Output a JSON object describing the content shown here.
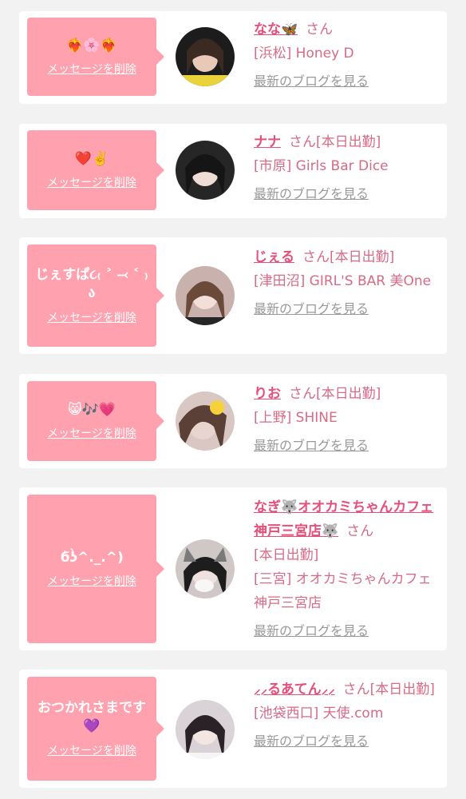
{
  "delete_label": "メッセージを削除",
  "blog_label": "最新のブログを見る",
  "san_label": "さん",
  "colors": {
    "bubble": "#ffa1ae",
    "name": "#e4507a",
    "text": "#d86a86",
    "link_gray": "#999999"
  },
  "items": [
    {
      "message": "❤️‍🔥🌸❤️‍🔥",
      "name": "なな🦋",
      "suffix": "",
      "shop": "[浜松] Honey D"
    },
    {
      "message": "❤️✌️",
      "name": "ナナ",
      "suffix": "[本日出勤]",
      "shop": "[市原] Girls Bar Dice"
    },
    {
      "message": "じぇすぱ૮₍ ˃ ⤙ ˂ ₎ა",
      "name": "じぇる",
      "suffix": "[本日出勤]",
      "shop": "[津田沼] GIRL'S BAR 美One"
    },
    {
      "message": "😸🎶💗",
      "name": "りお",
      "suffix": "[本日出勤]",
      "shop": "[上野] SHINE"
    },
    {
      "message": "ϭ̀ʖ̀^._.^)",
      "name": "なぎ🐺オオカミちゃんカフェ神戸三宮店🐺",
      "suffix": "[本日出勤]",
      "shop": "[三宮] オオカミちゃんカフェ神戸三宮店"
    },
    {
      "message": "おつかれさまです💜",
      "name": "⸝⸝るあてん⸝⸝",
      "suffix": "[本日出勤]",
      "shop": "[池袋西口] 天使.com"
    }
  ]
}
